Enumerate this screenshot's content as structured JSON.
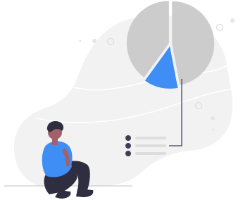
{
  "illustration": {
    "chart_data": {
      "type": "pie",
      "title": "",
      "slices": [
        {
          "label": "",
          "value": 40,
          "color": "#cccccc",
          "highlighted": false
        },
        {
          "label": "",
          "value": 47,
          "color": "#cccccc",
          "highlighted": false
        },
        {
          "label": "",
          "value": 13,
          "color": "#3f8ef5",
          "highlighted": true
        }
      ]
    },
    "legend": {
      "items": [
        {
          "dot_color": "#3f3d56",
          "line_color": "#dddddd"
        },
        {
          "dot_color": "#3f3d56",
          "line_color": "#dddddd"
        },
        {
          "dot_color": "#3f3d56",
          "line_color": "#dddddd"
        }
      ]
    },
    "colors": {
      "blob": "#f2f2f2",
      "accent": "#3f8ef5",
      "dark": "#3f3d56",
      "pie_gray": "#cccccc",
      "skin": "#a0616a",
      "hair": "#2f2e41"
    }
  }
}
